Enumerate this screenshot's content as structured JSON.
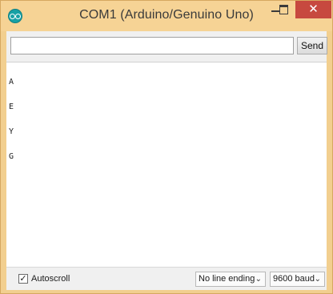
{
  "window": {
    "title": "COM1 (Arduino/Genuino Uno)",
    "icon": "arduino-icon",
    "controls": {
      "minimize": "minimize-icon",
      "maximize": "maximize-icon",
      "close_glyph": "✕"
    }
  },
  "input": {
    "value": "",
    "send_label": "Send"
  },
  "output": {
    "lines": [
      "A",
      "E",
      "Y",
      "G"
    ]
  },
  "statusbar": {
    "autoscroll_checked": true,
    "checkmark": "✓",
    "autoscroll_label": "Autoscroll",
    "line_ending": "No line ending",
    "baud_rate": "9600 baud",
    "chevron": "⌄"
  },
  "colors": {
    "titlebar": "#f6d395",
    "close_button": "#c7493f",
    "accent_icon": "#17a1a5"
  }
}
